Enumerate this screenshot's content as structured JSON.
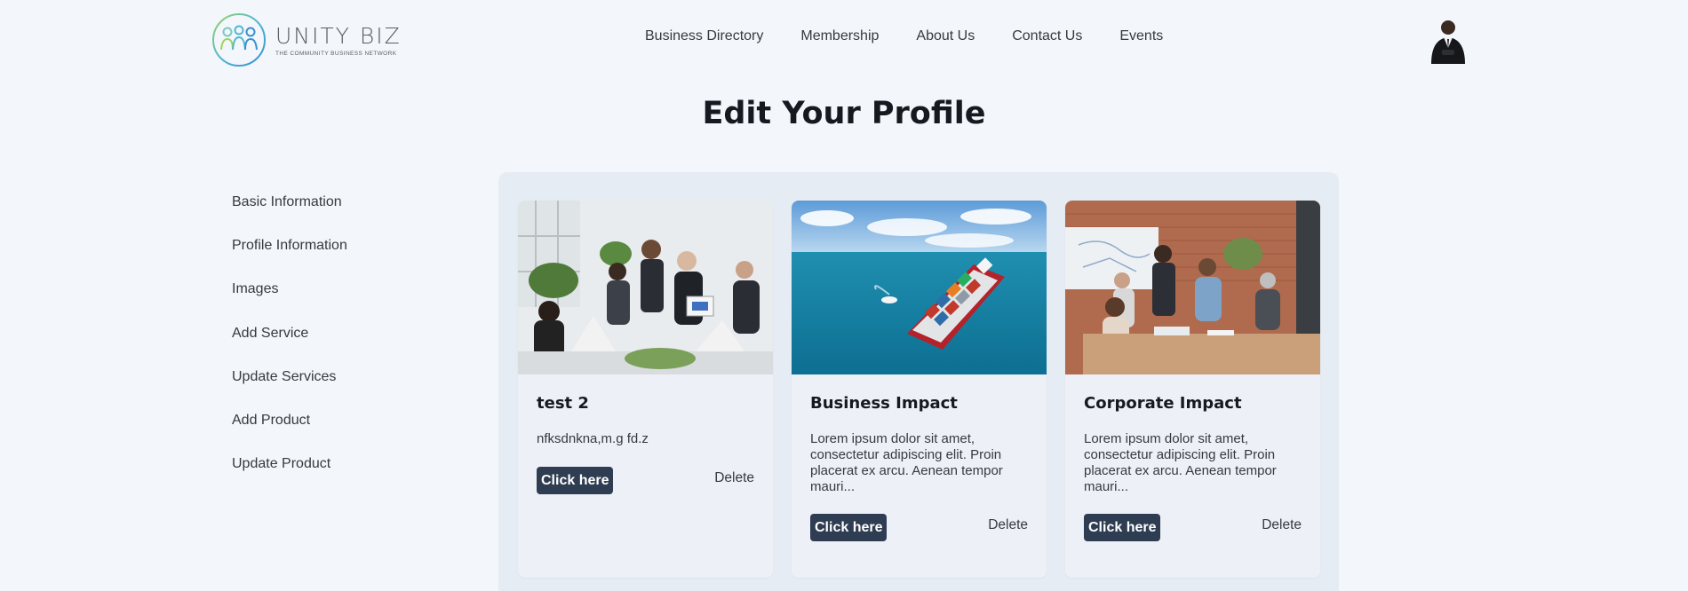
{
  "logo": {
    "title": "UNITY BIZ",
    "subtitle": "THE COMMUNITY BUSINESS NETWORK"
  },
  "nav": [
    "Business Directory",
    "Membership",
    "About Us",
    "Contact Us",
    "Events"
  ],
  "page_title": "Edit Your Profile",
  "sidebar": [
    "Basic Information",
    "Profile Information",
    "Images",
    "Add Service",
    "Update Services",
    "Add Product",
    "Update Product"
  ],
  "cards": [
    {
      "title": "test 2",
      "description": "nfksdnkna,m.g fd.z",
      "button": "Click here",
      "delete": "Delete",
      "image": "office-meeting-photo"
    },
    {
      "title": "Business Impact",
      "description": "Lorem ipsum dolor sit amet, consectetur adipiscing elit. Proin placerat ex arcu. Aenean tempor mauri...",
      "button": "Click here",
      "delete": "Delete",
      "image": "cargo-ship-photo"
    },
    {
      "title": "Corporate Impact",
      "description": "Lorem ipsum dolor sit amet, consectetur adipiscing elit. Proin placerat ex arcu. Aenean tempor mauri...",
      "button": "Click here",
      "delete": "Delete",
      "image": "team-meeting-photo"
    }
  ],
  "colors": {
    "background": "#f3f6fb",
    "panel": "#e6ecf4",
    "button": "#2f3d52"
  }
}
